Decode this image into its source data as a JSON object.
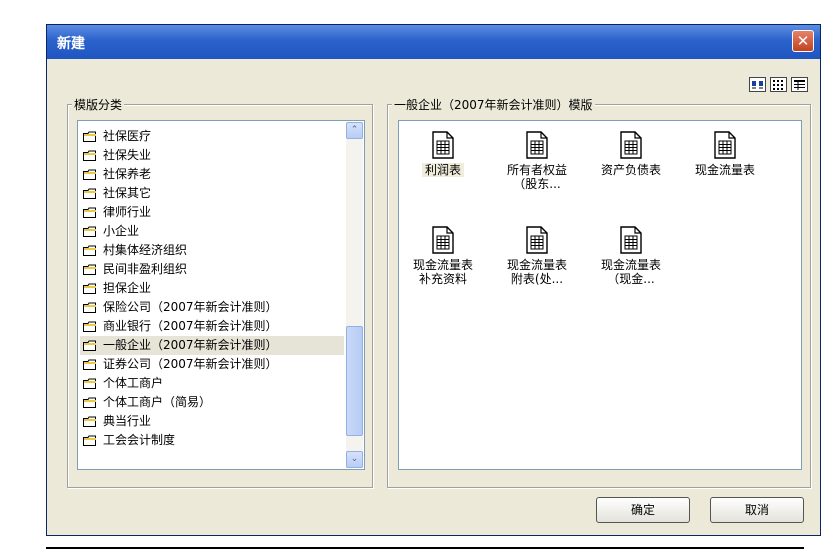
{
  "window": {
    "title": "新建",
    "close_glyph": "✕"
  },
  "view_icons": [
    "large-icons-icon",
    "small-icons-icon",
    "details-icon"
  ],
  "category_group": {
    "label": "模版分类",
    "items": [
      {
        "label": "社保医疗",
        "selected": false
      },
      {
        "label": "社保失业",
        "selected": false
      },
      {
        "label": "社保养老",
        "selected": false
      },
      {
        "label": "社保其它",
        "selected": false
      },
      {
        "label": "律师行业",
        "selected": false
      },
      {
        "label": "小企业",
        "selected": false
      },
      {
        "label": "村集体经济组织",
        "selected": false
      },
      {
        "label": "民间非盈利组织",
        "selected": false
      },
      {
        "label": "担保企业",
        "selected": false
      },
      {
        "label": "保险公司（2007年新会计准则）",
        "selected": false
      },
      {
        "label": "商业银行（2007年新会计准则）",
        "selected": false
      },
      {
        "label": "一般企业（2007年新会计准则）",
        "selected": true
      },
      {
        "label": "证券公司（2007年新会计准则）",
        "selected": false
      },
      {
        "label": "个体工商户",
        "selected": false
      },
      {
        "label": "个体工商户（简易）",
        "selected": false
      },
      {
        "label": "典当行业",
        "selected": false
      },
      {
        "label": "工会会计制度",
        "selected": false
      }
    ],
    "scroll_up_glyph": "⌃",
    "scroll_down_glyph": "⌄"
  },
  "template_group": {
    "label": "一般企业（2007年新会计准则）模版",
    "items": [
      {
        "line1": "利润表",
        "line2": "",
        "selected": true
      },
      {
        "line1": "所有者权益",
        "line2": "（股东...",
        "selected": false
      },
      {
        "line1": "资产负债表",
        "line2": "",
        "selected": false
      },
      {
        "line1": "现金流量表",
        "line2": "",
        "selected": false
      },
      {
        "line1": "现金流量表",
        "line2": "补充资料",
        "selected": false
      },
      {
        "line1": "现金流量表",
        "line2": "附表(处...",
        "selected": false
      },
      {
        "line1": "现金流量表",
        "line2": "（现金...",
        "selected": false
      }
    ]
  },
  "buttons": {
    "ok": "确定",
    "cancel": "取消"
  }
}
